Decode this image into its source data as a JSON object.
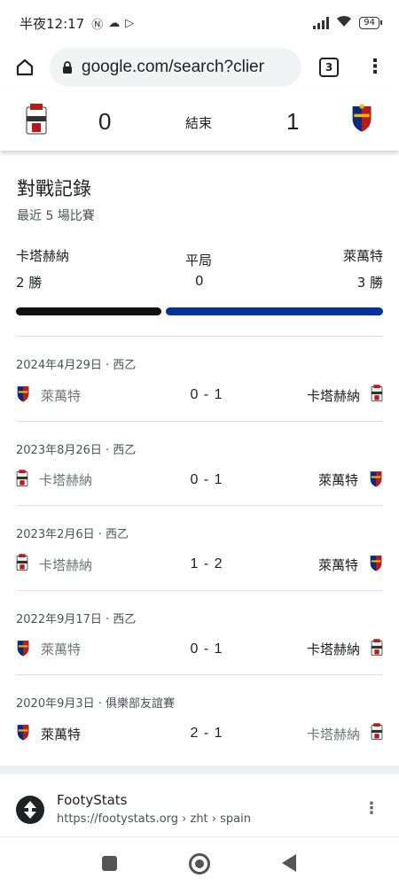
{
  "status_bar": {
    "time": "半夜12:17",
    "battery": "94"
  },
  "browser": {
    "url": "google.com/search?clier",
    "tab_count": "3"
  },
  "score_header": {
    "home_score": "0",
    "status": "結束",
    "away_score": "1"
  },
  "h2h": {
    "title": "對戰記錄",
    "subtitle": "最近 5 場比賽",
    "left_team": "卡塔赫納",
    "left_wins": "2 勝",
    "draw_label": "平局",
    "draw_count": "0",
    "right_team": "萊萬特",
    "right_wins": "3 勝",
    "bar_left_fraction": 0.4,
    "bar_right_fraction": 0.6,
    "colors": {
      "left": "#111111",
      "right": "#003399"
    }
  },
  "matches": [
    {
      "date": "2024年4月29日 · 西乙",
      "home": "萊萬特",
      "home_crest": "levante-crest-icon",
      "score": "0 - 1",
      "away": "卡塔赫納",
      "away_crest": "cartagena-crest-icon",
      "winner": "away"
    },
    {
      "date": "2023年8月26日 · 西乙",
      "home": "卡塔赫納",
      "home_crest": "cartagena-crest-icon",
      "score": "0 - 1",
      "away": "萊萬特",
      "away_crest": "levante-crest-icon",
      "winner": "away"
    },
    {
      "date": "2023年2月6日 · 西乙",
      "home": "卡塔赫納",
      "home_crest": "cartagena-crest-icon",
      "score": "1 - 2",
      "away": "萊萬特",
      "away_crest": "levante-crest-icon",
      "winner": "away"
    },
    {
      "date": "2022年9月17日 · 西乙",
      "home": "萊萬特",
      "home_crest": "levante-crest-icon",
      "score": "0 - 1",
      "away": "卡塔赫納",
      "away_crest": "cartagena-crest-icon",
      "winner": "away"
    },
    {
      "date": "2020年9月3日 · 俱樂部友誼賽",
      "home": "萊萬特",
      "home_crest": "levante-crest-icon",
      "score": "2 - 1",
      "away": "卡塔赫納",
      "away_crest": "cartagena-crest-icon",
      "winner": "home"
    }
  ],
  "result": {
    "name": "FootyStats",
    "url": "https://footystats.org › zht › spain"
  }
}
